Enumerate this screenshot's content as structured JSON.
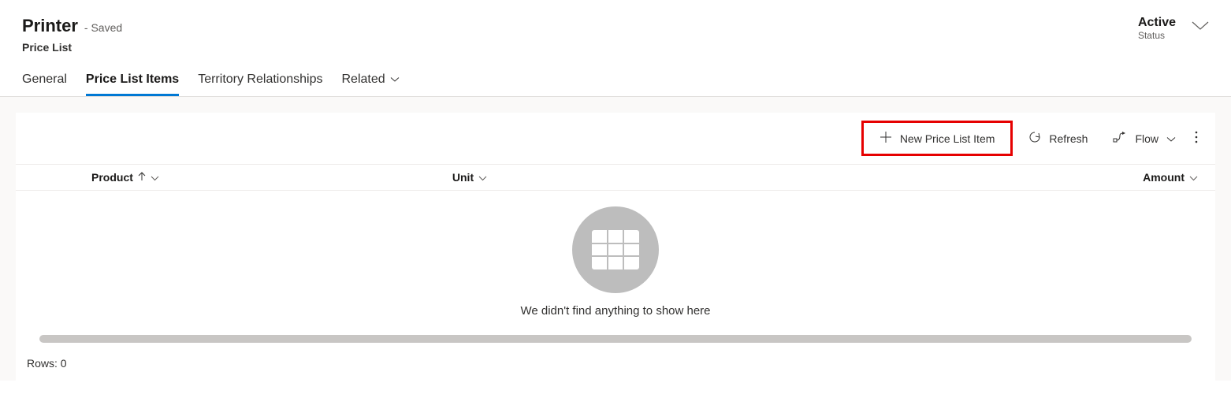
{
  "header": {
    "title": "Printer",
    "saved_suffix": "- Saved",
    "subtitle": "Price List",
    "status_value": "Active",
    "status_label": "Status"
  },
  "tabs": {
    "general": "General",
    "price_list_items": "Price List Items",
    "territory_relationships": "Territory Relationships",
    "related": "Related"
  },
  "toolbar": {
    "new_price_list_item": "New Price List Item",
    "refresh": "Refresh",
    "flow": "Flow"
  },
  "columns": {
    "product": "Product",
    "unit": "Unit",
    "amount": "Amount"
  },
  "empty_state": {
    "message": "We didn't find anything to show here"
  },
  "footer": {
    "rows_label": "Rows: 0"
  }
}
